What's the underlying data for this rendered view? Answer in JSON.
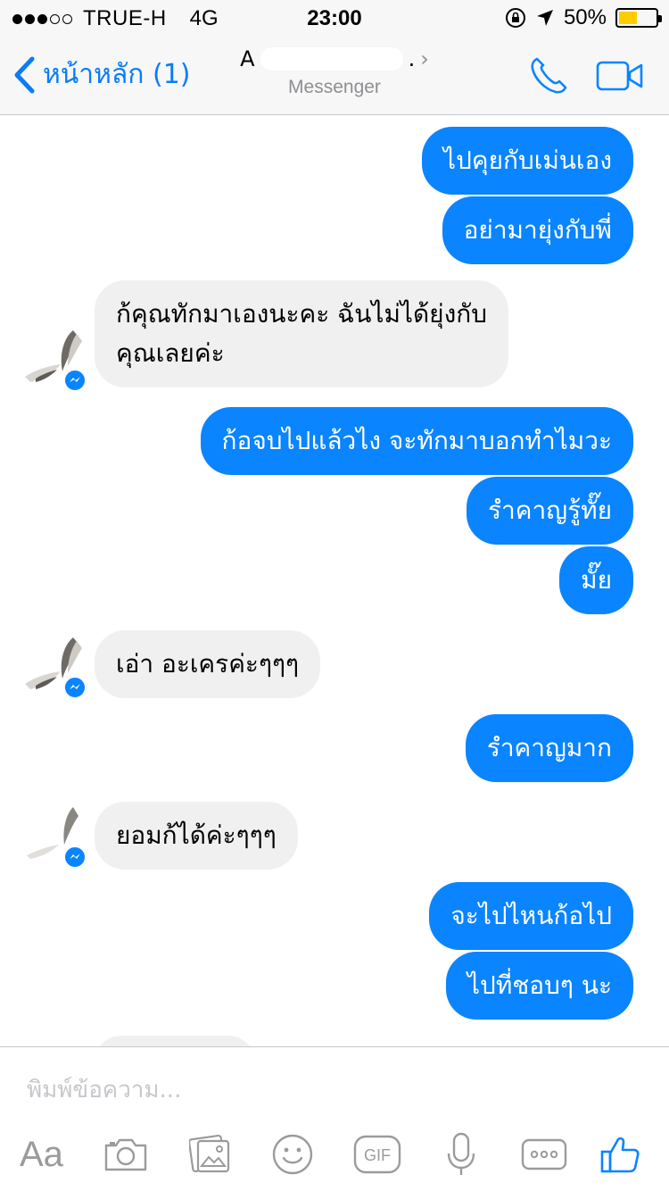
{
  "status_bar": {
    "carrier": "TRUE-H",
    "network": "4G",
    "time": "23:00",
    "battery": "50%",
    "battery_level": 0.5,
    "signal_bars": 3,
    "signal_total": 5
  },
  "nav": {
    "back_label": "หน้าหลัก (1)",
    "contact_initial": "A",
    "contact_suffix": ".",
    "subtitle": "Messenger"
  },
  "messages": [
    {
      "from": "me",
      "text": "ไปคุยกับเม่นเอง"
    },
    {
      "from": "me",
      "text": "อย่ามายุ่งกับพี่"
    },
    {
      "from": "them",
      "lines": [
        "ก้คุณทักมาเองนะคะ ฉันไม่ได้ยุ่งกับ",
        "คุณเลยค่ะ"
      ]
    },
    {
      "from": "me",
      "text": "ก้อจบไปแล้วไง จะทักมาบอกทำไมวะ"
    },
    {
      "from": "me",
      "text": "รำคาญรู้ทั๊ย"
    },
    {
      "from": "me",
      "text": "มั๊ย"
    },
    {
      "from": "them",
      "text": "เอ่า อะเครค่ะๆๆๆ"
    },
    {
      "from": "me",
      "text": "รำคาญมาก"
    },
    {
      "from": "them",
      "text": "ยอมก้ได้ค่ะๆๆๆ"
    },
    {
      "from": "me",
      "text": "จะไปไหนก้อไป"
    },
    {
      "from": "me",
      "text": "ไปที่ชอบๆ นะ"
    }
  ],
  "composer": {
    "placeholder": "พิมพ์ข้อความ...",
    "aa_label": "Aa",
    "gif_label": "GIF"
  },
  "colors": {
    "accent": "#0a84ff",
    "incoming_bubble": "#f1f0f0",
    "icon_gray": "#9b9b9b"
  }
}
